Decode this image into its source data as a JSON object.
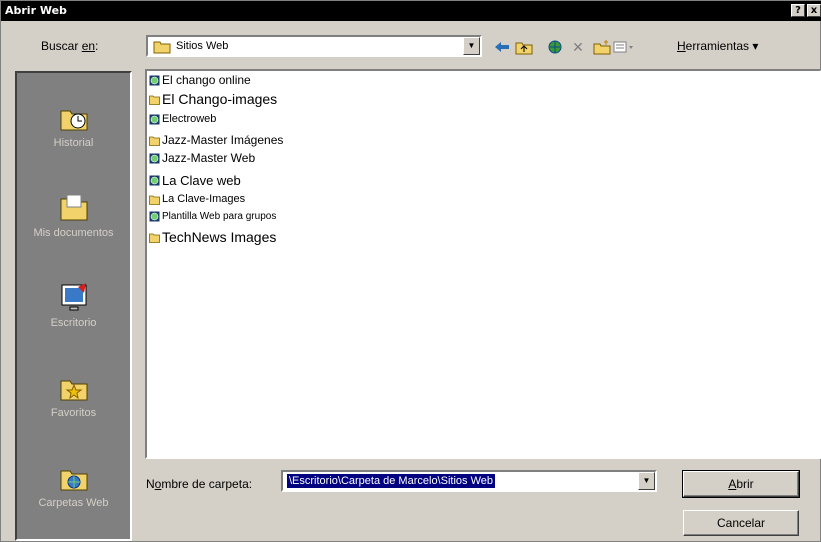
{
  "window": {
    "title": "Abrir Web",
    "help_label": "?",
    "close_label": "x"
  },
  "lookin": {
    "label_pre": "Buscar ",
    "label_key": "en",
    "label_post": ":",
    "value": "Sitios Web"
  },
  "toolbar": {
    "tools_key": "H",
    "tools_rest": "erramientas",
    "tools_arrow": "▾"
  },
  "places": [
    {
      "label": "Historial",
      "icon": "history-icon"
    },
    {
      "label": "Mis documentos",
      "icon": "my-documents-icon"
    },
    {
      "label": "Escritorio",
      "icon": "desktop-icon"
    },
    {
      "label": "Favoritos",
      "icon": "favorites-icon"
    },
    {
      "label": "Carpetas Web",
      "icon": "web-folders-icon"
    }
  ],
  "files": [
    {
      "name": "El chango online",
      "type": "web",
      "size": 12
    },
    {
      "name": "El Chango-images",
      "type": "folder",
      "size": 14
    },
    {
      "name": "Electroweb",
      "type": "web",
      "size": 11
    },
    {
      "name": "Jazz-Master Imágenes",
      "type": "folder",
      "size": 12
    },
    {
      "name": "Jazz-Master Web",
      "type": "web",
      "size": 12
    },
    {
      "name": "La Clave web",
      "type": "web",
      "size": 13
    },
    {
      "name": "La Clave-Images",
      "type": "folder",
      "size": 11
    },
    {
      "name": "Plantilla Web para grupos",
      "type": "web",
      "size": 10
    },
    {
      "name": "TechNews Images",
      "type": "folder",
      "size": 14
    }
  ],
  "filename": {
    "label_pre": "N",
    "label_key": "o",
    "label_post": "mbre de carpeta:",
    "value": "\\Escritorio\\Carpeta de Marcelo\\Sitios Web"
  },
  "buttons": {
    "open_key": "A",
    "open_rest": "brir",
    "cancel": "Cancelar"
  },
  "colors": {
    "titlebar": "#000000",
    "dialog": "#d4d0c8",
    "places_bar": "#808080",
    "selection": "#000080",
    "folder": "#f2d36b"
  }
}
